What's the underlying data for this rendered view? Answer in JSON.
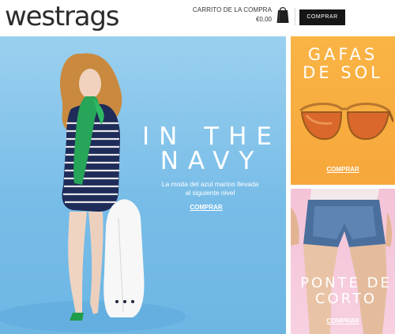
{
  "header": {
    "logo_text": "westrags",
    "cart": {
      "title": "CARRITO DE LA COMPRA",
      "total": "€0,00",
      "icon": "shopping-bag-icon"
    },
    "buy_button": "COMPRAR"
  },
  "hero": {
    "title_line1": "IN THE",
    "title_line2": "NAVY",
    "subtitle_line1": "La moda del azul marino llevada",
    "subtitle_line2": "al siguiente nivel",
    "link": "COMPRAR",
    "background_color": "#7cc0ea"
  },
  "promos": [
    {
      "title_line1": "GAFAS",
      "title_line2": "DE SOL",
      "link": "COMPRAR",
      "background_color": "#f8ae41"
    },
    {
      "title_line1": "PONTE DE",
      "title_line2": "CORTO",
      "link": "COMPRAR",
      "background_color": "#f5c9dc"
    }
  ]
}
